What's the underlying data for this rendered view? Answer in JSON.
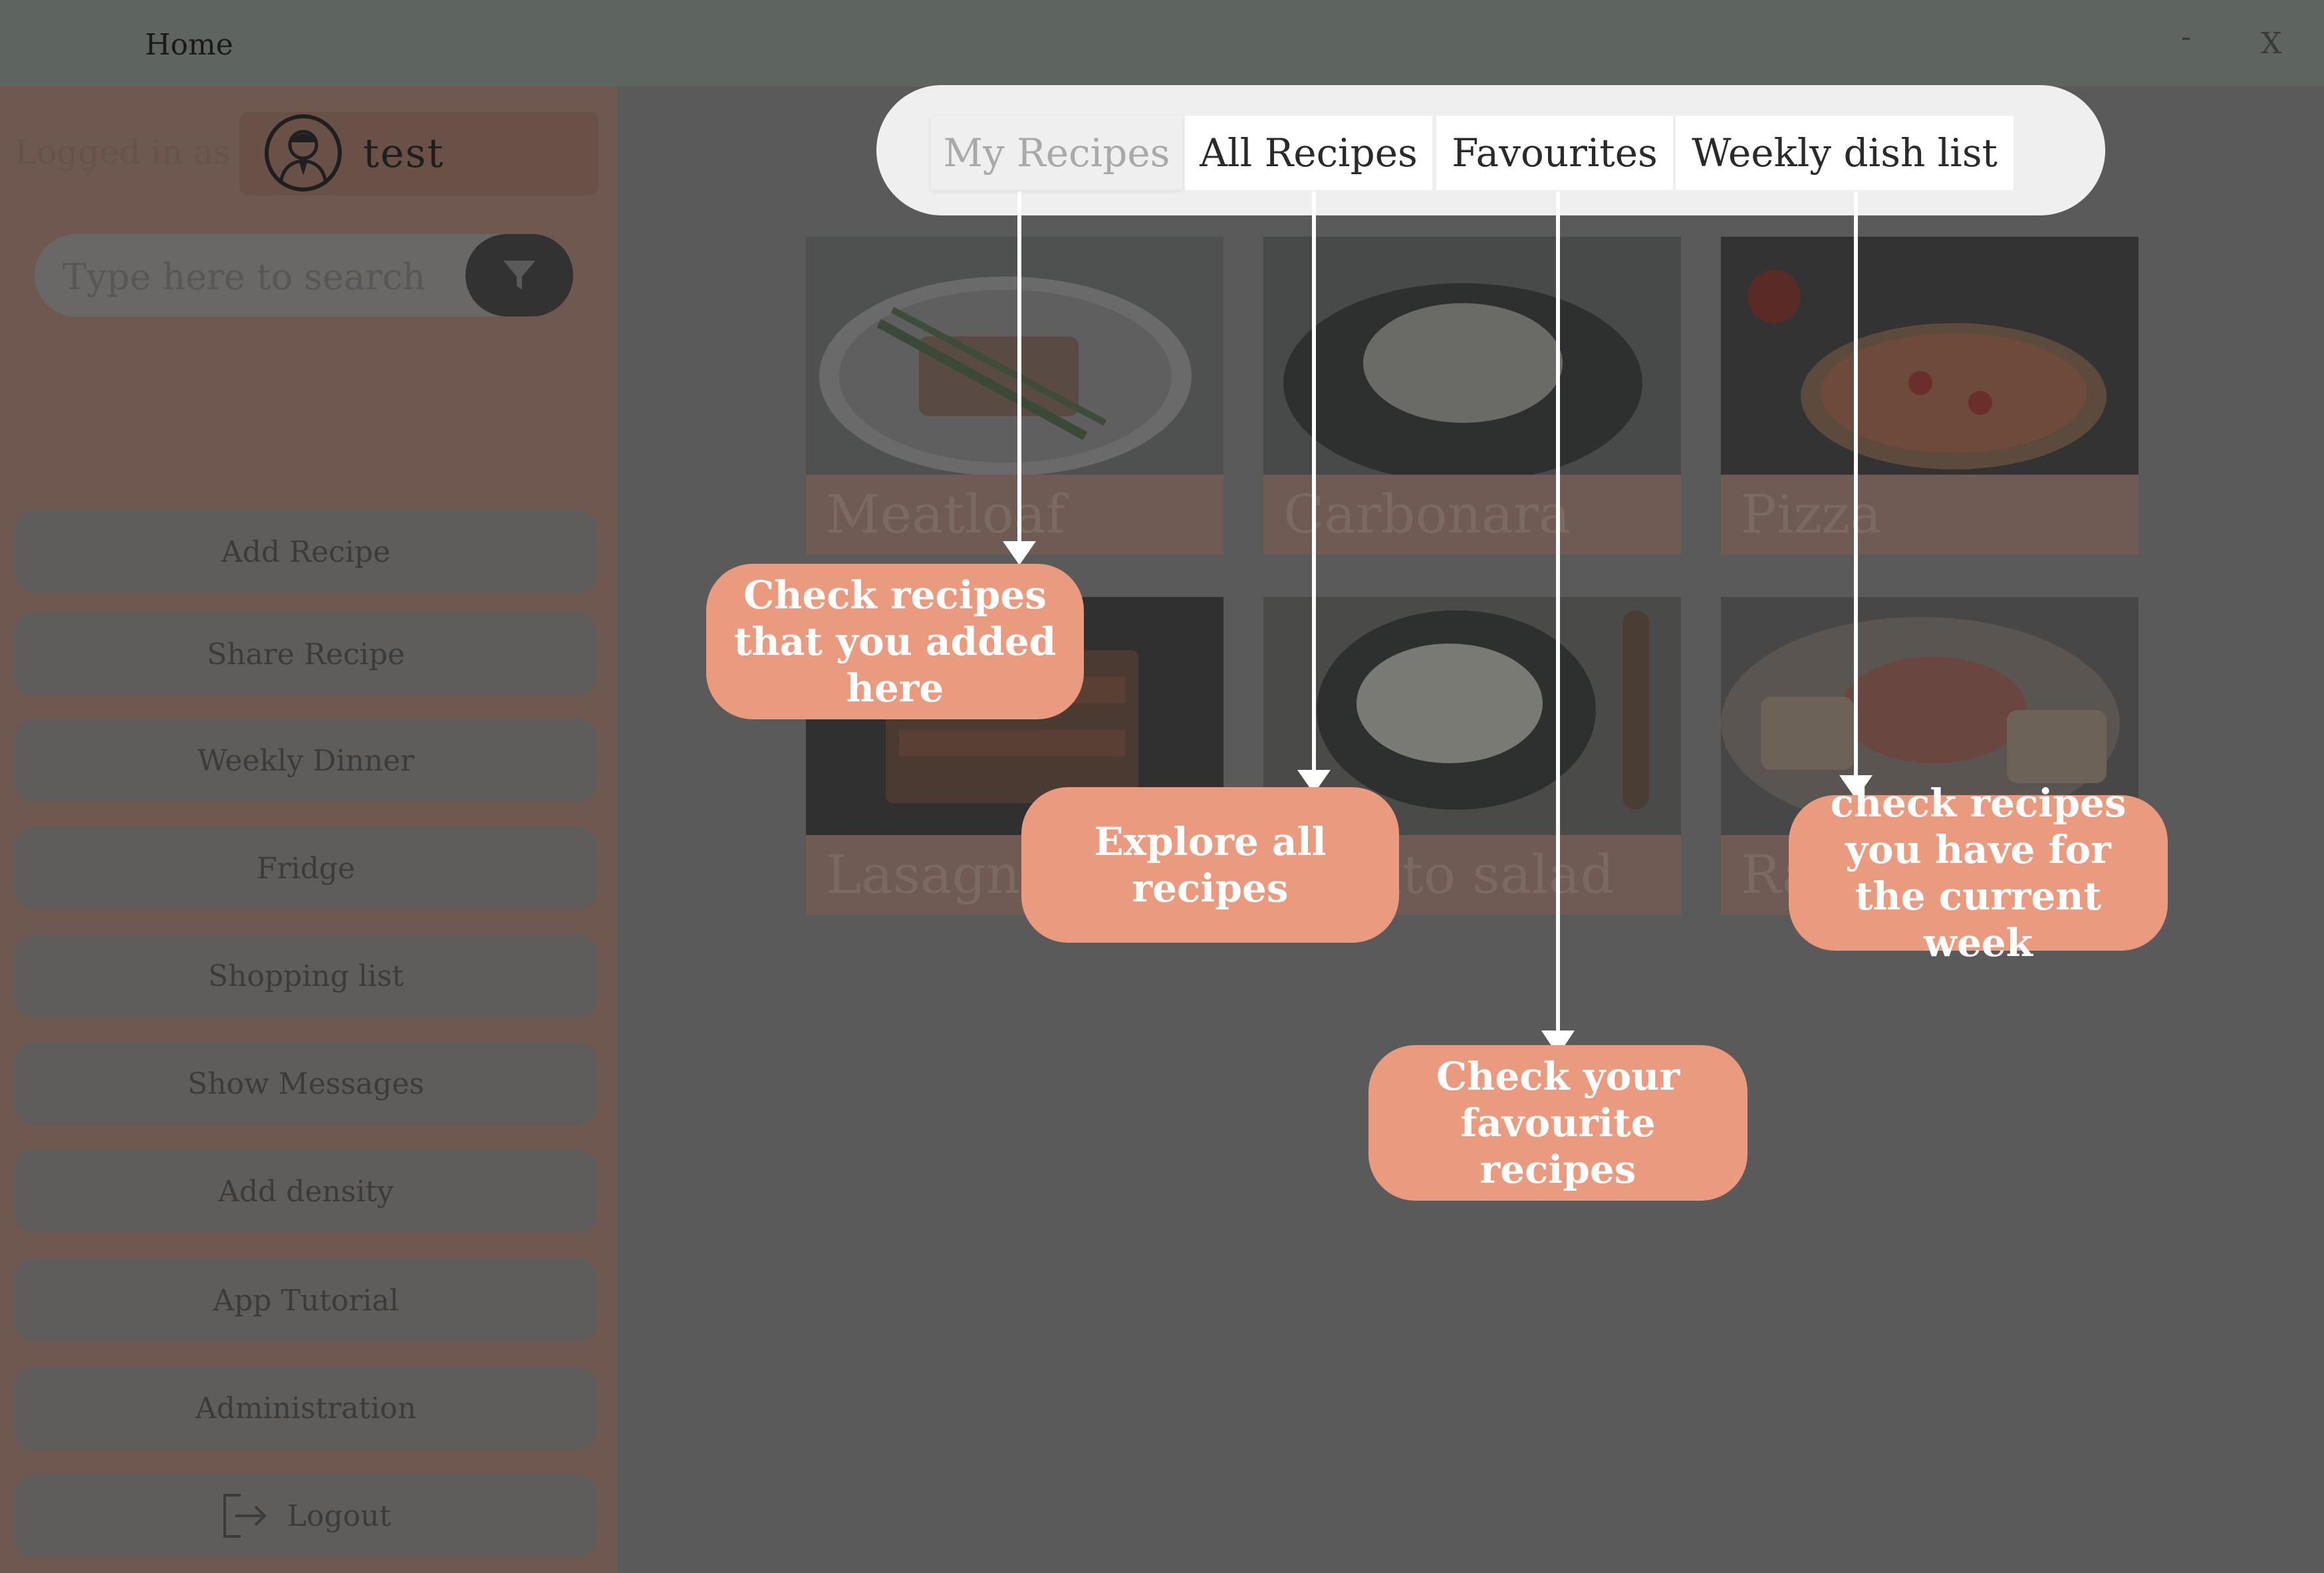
{
  "window": {
    "title": "Home",
    "minimize": "-",
    "close": "X"
  },
  "sidebar": {
    "logged_label": "Logged in as",
    "username": "test",
    "search_placeholder": "Type here to search",
    "items": [
      {
        "label": "Add Recipe"
      },
      {
        "label": "Share Recipe"
      },
      {
        "label": "Weekly Dinner"
      },
      {
        "label": "Fridge"
      },
      {
        "label": "Shopping list"
      },
      {
        "label": "Show Messages"
      },
      {
        "label": "Add density"
      },
      {
        "label": "App Tutorial"
      },
      {
        "label": "Administration"
      },
      {
        "label": "Logout"
      }
    ]
  },
  "tabs": [
    {
      "label": "My Recipes"
    },
    {
      "label": "All Recipes"
    },
    {
      "label": "Favourites"
    },
    {
      "label": "Weekly dish list"
    }
  ],
  "recipes": [
    {
      "name": "Meatloaf"
    },
    {
      "name": "Carbonara"
    },
    {
      "name": "Pizza"
    },
    {
      "name": "Lasagna"
    },
    {
      "name": "Potato salad"
    },
    {
      "name": "Ravioli"
    }
  ],
  "tutorial": {
    "my_recipes": "Check recipes that you added here",
    "all_recipes": "Explore all recipes",
    "favourites": "Check your favourite recipes",
    "weekly": "check recipes you have for the current week"
  },
  "colors": {
    "callout": "#ea9a7f",
    "overlay": "#5a5a5a",
    "sidebar": "#6e584f"
  },
  "icons": {
    "avatar": "user-avatar-icon",
    "filter": "funnel-icon",
    "logout": "logout-icon"
  }
}
